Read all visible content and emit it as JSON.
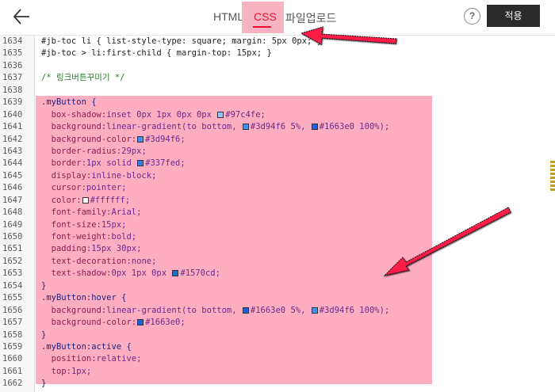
{
  "header": {
    "tabs": [
      {
        "label": "HTML"
      },
      {
        "label": "CSS"
      },
      {
        "label": "파일업로드"
      }
    ],
    "help_label": "?",
    "apply_label": "적용"
  },
  "colors": {
    "accent": "#e8112d",
    "highlight": "#ffadc0",
    "arrow": "#ff1a4a"
  },
  "editor": {
    "lines": [
      {
        "n": "1634",
        "segments": [
          {
            "t": "#jb-toc li { list-style-type: square; margin: 5px 0px; }",
            "c": ""
          }
        ]
      },
      {
        "n": "1635",
        "segments": [
          {
            "t": "#jb-toc > li:first-child { margin-top: 15px; }",
            "c": ""
          }
        ]
      },
      {
        "n": "1636",
        "segments": []
      },
      {
        "n": "1637",
        "segments": [
          {
            "t": "/* 링크버튼꾸미기 */",
            "c": "cm"
          }
        ]
      },
      {
        "n": "1638",
        "segments": []
      },
      {
        "n": "1639",
        "segments": [
          {
            "t": ".myButton {",
            "c": "sel"
          }
        ]
      },
      {
        "n": "1640",
        "segments": [
          {
            "t": "  box-shadow:",
            "c": "prop"
          },
          {
            "t": "inset 0px 1px 0px 0px ",
            "c": "val"
          },
          {
            "sw": "#97c4fe"
          },
          {
            "t": "#97c4fe;",
            "c": "val"
          }
        ]
      },
      {
        "n": "1641",
        "segments": [
          {
            "t": "  background:",
            "c": "prop"
          },
          {
            "t": "linear-gradient(to bottom, ",
            "c": "val"
          },
          {
            "sw": "#3d94f6"
          },
          {
            "t": "#3d94f6 5%, ",
            "c": "val"
          },
          {
            "sw": "#1663e0"
          },
          {
            "t": "#1663e0 100%);",
            "c": "val"
          }
        ]
      },
      {
        "n": "1642",
        "segments": [
          {
            "t": "  background-color:",
            "c": "prop"
          },
          {
            "sw": "#3d94f6"
          },
          {
            "t": "#3d94f6;",
            "c": "val"
          }
        ]
      },
      {
        "n": "1643",
        "segments": [
          {
            "t": "  border-radius:",
            "c": "prop"
          },
          {
            "t": "29px;",
            "c": "val"
          }
        ]
      },
      {
        "n": "1644",
        "segments": [
          {
            "t": "  border:",
            "c": "prop"
          },
          {
            "t": "1px solid ",
            "c": "val"
          },
          {
            "sw": "#337fed"
          },
          {
            "t": "#337fed;",
            "c": "val"
          }
        ]
      },
      {
        "n": "1645",
        "segments": [
          {
            "t": "  display:",
            "c": "prop"
          },
          {
            "t": "inline-block;",
            "c": "val"
          }
        ]
      },
      {
        "n": "1646",
        "segments": [
          {
            "t": "  cursor:",
            "c": "prop"
          },
          {
            "t": "pointer;",
            "c": "val"
          }
        ]
      },
      {
        "n": "1647",
        "segments": [
          {
            "t": "  color:",
            "c": "prop"
          },
          {
            "sw": "#ffffff"
          },
          {
            "t": "#ffffff;",
            "c": "val"
          }
        ]
      },
      {
        "n": "1648",
        "segments": [
          {
            "t": "  font-family:",
            "c": "prop"
          },
          {
            "t": "Arial;",
            "c": "val"
          }
        ]
      },
      {
        "n": "1649",
        "segments": [
          {
            "t": "  font-size:",
            "c": "prop"
          },
          {
            "t": "15px;",
            "c": "val"
          }
        ]
      },
      {
        "n": "1650",
        "segments": [
          {
            "t": "  font-weight:",
            "c": "prop"
          },
          {
            "t": "bold;",
            "c": "val"
          }
        ]
      },
      {
        "n": "1651",
        "segments": [
          {
            "t": "  padding:",
            "c": "prop"
          },
          {
            "t": "15px 30px;",
            "c": "val"
          }
        ]
      },
      {
        "n": "1652",
        "segments": [
          {
            "t": "  text-decoration:",
            "c": "prop"
          },
          {
            "t": "none;",
            "c": "val"
          }
        ]
      },
      {
        "n": "1653",
        "segments": [
          {
            "t": "  text-shadow:",
            "c": "prop"
          },
          {
            "t": "0px 1px 0px ",
            "c": "val"
          },
          {
            "sw": "#1570cd"
          },
          {
            "t": "#1570cd;",
            "c": "val"
          }
        ]
      },
      {
        "n": "1654",
        "segments": [
          {
            "t": "}",
            "c": "sel"
          }
        ]
      },
      {
        "n": "1655",
        "segments": [
          {
            "t": ".myButton:hover {",
            "c": "sel"
          }
        ]
      },
      {
        "n": "1656",
        "segments": [
          {
            "t": "  background:",
            "c": "prop"
          },
          {
            "t": "linear-gradient(to bottom, ",
            "c": "val"
          },
          {
            "sw": "#1663e0"
          },
          {
            "t": "#1663e0 5%, ",
            "c": "val"
          },
          {
            "sw": "#3d94f6"
          },
          {
            "t": "#3d94f6 100%);",
            "c": "val"
          }
        ]
      },
      {
        "n": "1657",
        "segments": [
          {
            "t": "  background-color:",
            "c": "prop"
          },
          {
            "sw": "#1663e0"
          },
          {
            "t": "#1663e0;",
            "c": "val"
          }
        ]
      },
      {
        "n": "1658",
        "segments": [
          {
            "t": "}",
            "c": "sel"
          }
        ]
      },
      {
        "n": "1659",
        "segments": [
          {
            "t": ".myButton:active {",
            "c": "sel"
          }
        ]
      },
      {
        "n": "1660",
        "segments": [
          {
            "t": "  position:",
            "c": "prop"
          },
          {
            "t": "relative;",
            "c": "val"
          }
        ]
      },
      {
        "n": "1661",
        "segments": [
          {
            "t": "  top:",
            "c": "prop"
          },
          {
            "t": "1px;",
            "c": "val"
          }
        ]
      },
      {
        "n": "1662",
        "segments": [
          {
            "t": "}",
            "c": "sel"
          }
        ]
      },
      {
        "n": "1663",
        "segments": []
      }
    ]
  }
}
